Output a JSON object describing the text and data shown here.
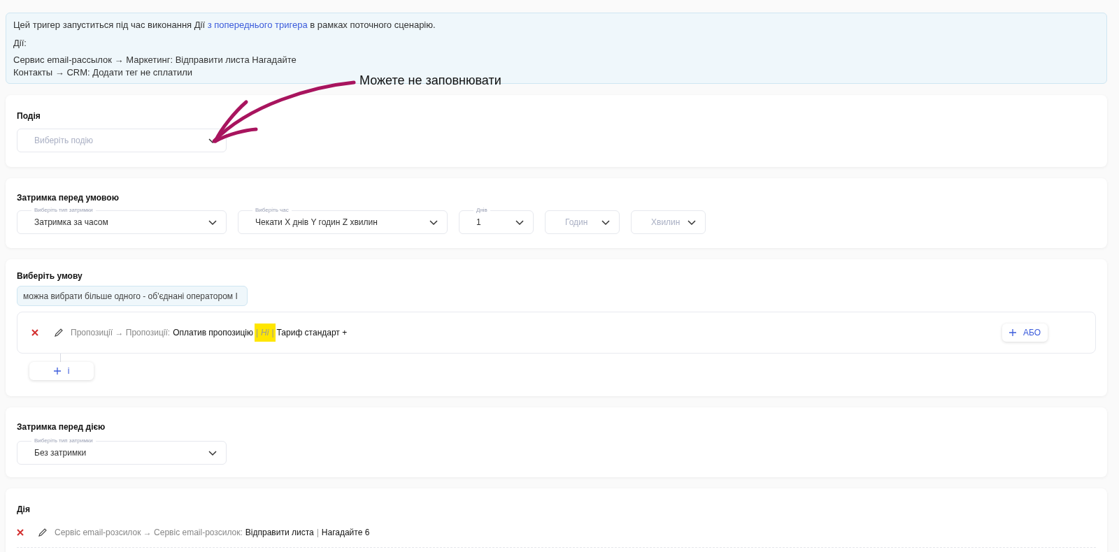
{
  "info": {
    "before": "Цей тригер запуститься під час виконання Дії",
    "link": "з попереднього тригера",
    "after": "в рамках поточного сценарію.",
    "actions_label": "Дії:",
    "actions": [
      "Сервис email-рассылок → Маркетинг: Відправити листа Нагадайте",
      "Контакты → CRM: Додати тег не сплатили"
    ]
  },
  "annotation": {
    "text": "Можете не заповнювати"
  },
  "event": {
    "title": "Подія",
    "select": {
      "placeholder": "Виберіть подію"
    }
  },
  "condition_delay": {
    "title": "Затримка перед умовою",
    "selects": [
      {
        "label": "Виберіть тип затримки",
        "value": "Затримка за часом"
      },
      {
        "label": "Виберіть час",
        "value": "Чекати X днів Y годин Z хвилин"
      },
      {
        "label": "Днів",
        "value": "1"
      },
      {
        "placeholder": "Годин"
      },
      {
        "placeholder": "Хвилин"
      }
    ]
  },
  "condition": {
    "title": "Виберіть умову",
    "hint": "можна вибрати більше одного - об'єднані оператором І",
    "rules": [
      {
        "parts": [
          {
            "kind": "path",
            "text": "Пропозиції → Пропозиції:"
          },
          {
            "kind": "value",
            "text": "Оплатив пропозицію"
          },
          {
            "kind": "separator",
            "text": "|",
            "highlight": true
          },
          {
            "kind": "negation",
            "text": "Ні",
            "highlight": true
          },
          {
            "kind": "separator",
            "text": "|",
            "highlight": true
          },
          {
            "kind": "value",
            "text": "Тариф стандарт +"
          }
        ]
      }
    ],
    "or_button": "АБО",
    "and_button": "і"
  },
  "action_delay": {
    "title": "Затримка перед дією",
    "selects": [
      {
        "label": "Виберіть тип затримки",
        "value": "Без затримки"
      }
    ]
  },
  "action": {
    "title": "Дія",
    "items": [
      {
        "parts": [
          {
            "kind": "path",
            "text": "Сервіс email-розсилок → Сервіс email-розсилок:"
          },
          {
            "kind": "value",
            "text": "Відправити листа"
          },
          {
            "kind": "separator",
            "text": "|"
          },
          {
            "kind": "value",
            "text": "Нагадайте 6"
          }
        ]
      }
    ]
  }
}
